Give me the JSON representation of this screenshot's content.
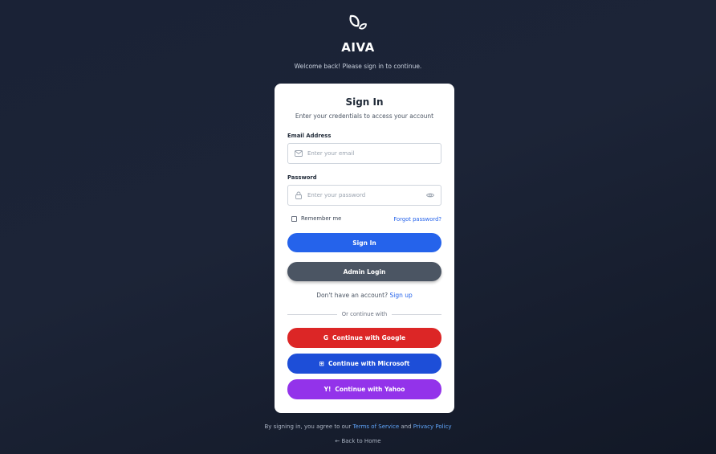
{
  "brand": {
    "logo_icon": "leaf-icon",
    "name": "AIVA",
    "welcome": "Welcome back! Please sign in to continue."
  },
  "card": {
    "title": "Sign In",
    "subtitle": "Enter your credentials to access your account",
    "email": {
      "label": "Email Address",
      "placeholder": "Enter your email",
      "icon": "mail-icon"
    },
    "password": {
      "label": "Password",
      "placeholder": "Enter your password",
      "icon": "lock-icon",
      "toggle_icon": "eye-icon"
    },
    "remember_label": "Remember me",
    "forgot_label": "Forgot password?",
    "sign_in_label": "Sign In",
    "admin_login_label": "Admin Login",
    "no_account_text": "Don't have an account?",
    "sign_up_label": "Sign up",
    "divider_text": "Or continue with",
    "social": {
      "google": {
        "label": "Continue with Google",
        "icon_text": "G",
        "color": "#dc2626"
      },
      "microsoft": {
        "label": "Continue with Microsoft",
        "icon_text": "⊞",
        "color": "#1d4ed8"
      },
      "yahoo": {
        "label": "Continue with Yahoo",
        "icon_text": "Y!",
        "color": "#9333ea"
      }
    }
  },
  "footer": {
    "prefix": "By signing in, you agree to our",
    "terms_label": "Terms of Service",
    "and": "and",
    "privacy_label": "Privacy Policy",
    "back_label": "← Back to Home"
  },
  "colors": {
    "primary": "#2563eb",
    "admin": "#4b5563",
    "background": "#1a2236"
  }
}
